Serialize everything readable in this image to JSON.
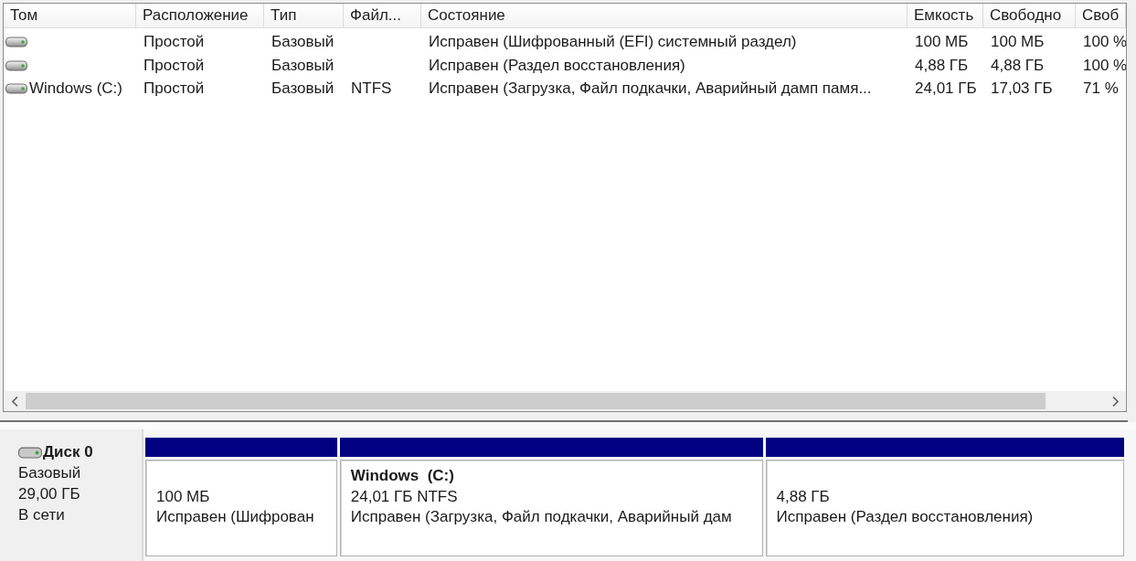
{
  "volume_list": {
    "columns": [
      "Том",
      "Расположение",
      "Тип",
      "Файл...",
      "Состояние",
      "Емкость",
      "Свободно",
      "Своб"
    ],
    "rows": [
      {
        "layout": "Простой",
        "type": "Базовый",
        "status": "Исправен (Шифрованный (EFI) системный раздел)",
        "capacity": "100 МБ",
        "free_space": "100 МБ",
        "column_8": "100 %"
      },
      {
        "layout": "Простой",
        "type": "Базовый",
        "status": "Исправен (Раздел восстановления)",
        "capacity": "4,88 ГБ",
        "free_space": "4,88 ГБ",
        "column_8": "100 %"
      },
      {
        "volume": "Windows (C:)",
        "layout": "Простой",
        "type": "Базовый",
        "file_system": "NTFS",
        "status": "Исправен (Загрузка, Файл подкачки, Аварийный дамп памя...",
        "capacity": "24,01 ГБ",
        "free_space": "17,03 ГБ",
        "column_8": "71 %"
      }
    ]
  },
  "disks": [
    {
      "name": "Диск 0",
      "type": "Базовый",
      "size": "29,00 ГБ",
      "status": "В сети",
      "partitions": [
        {
          "size": "100 МБ",
          "status": "Исправен (Шифрован"
        },
        {
          "label": "Windows  (C:)",
          "size": "24,01 ГБ NTFS",
          "status": "Исправен (Загрузка, Файл подкачки, Аварийный дам"
        },
        {
          "size": "4,88 ГБ",
          "status": "Исправен (Раздел восстановления)"
        }
      ]
    }
  ]
}
